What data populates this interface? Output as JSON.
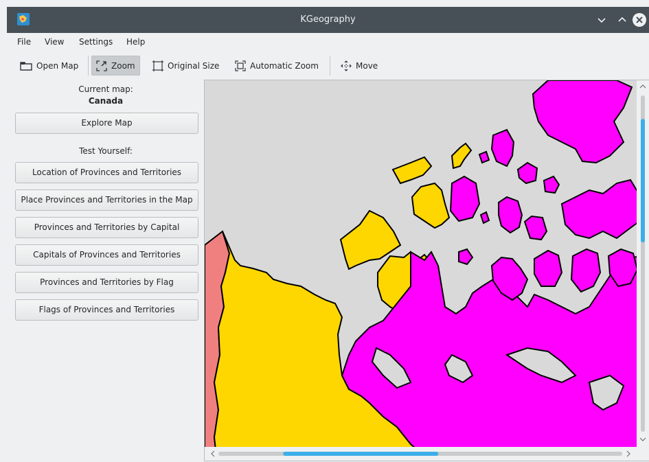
{
  "window": {
    "title": "KGeography"
  },
  "menu": [
    "File",
    "View",
    "Settings",
    "Help"
  ],
  "toolbar": {
    "open_map": "Open Map",
    "zoom": "Zoom",
    "original_size": "Original Size",
    "automatic_zoom": "Automatic Zoom",
    "move": "Move"
  },
  "panel": {
    "current_map_label": "Current map:",
    "current_map_name": "Canada",
    "explore_button": "Explore Map",
    "test_label": "Test Yourself:",
    "tests": [
      "Location of Provinces and Territories",
      "Place Provinces and Territories in the Map",
      "Provinces and Territories by Capital",
      "Capitals of Provinces and Territories",
      "Provinces and Territories by Flag",
      "Flags of Provinces and Territories"
    ]
  },
  "map": {
    "colors": {
      "water": "#d9d9d9",
      "yukon": "#f08080",
      "northwest_territories": "#ffd700",
      "nunavut": "#ff00ff",
      "outline": "#000000"
    }
  },
  "scrollbars": {
    "accent": "#3daee9",
    "vertical_position": 0.11,
    "horizontal_position": 0.15
  }
}
